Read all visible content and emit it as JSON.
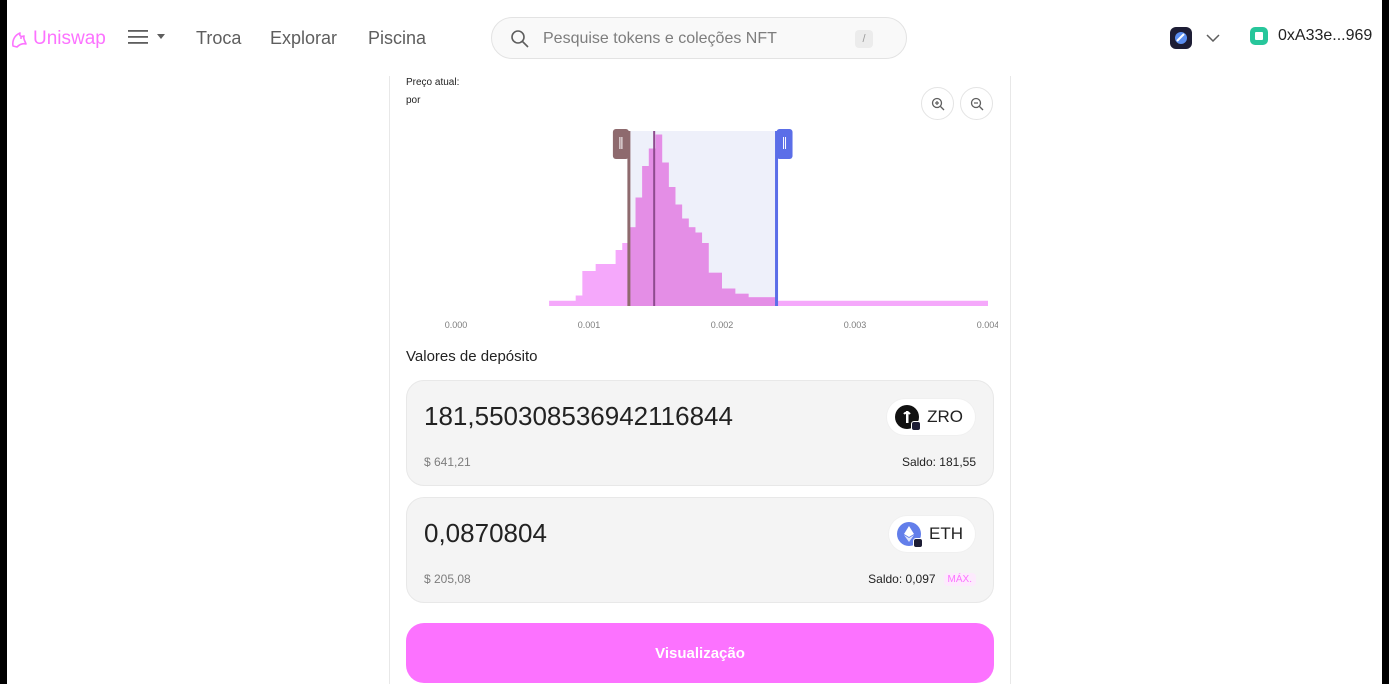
{
  "header": {
    "brand": "Uniswap",
    "nav": [
      "Troca",
      "Explorar",
      "Piscina"
    ],
    "search": {
      "placeholder": "Pesquise tokens e coleções NFT",
      "shortcut": "/"
    },
    "wallet_address": "0xA33e...969"
  },
  "range": {
    "price_label": "Preço atual:",
    "price_sub": "por"
  },
  "chart_data": {
    "type": "area",
    "x_ticks": [
      "0.000",
      "0.001",
      "0.002",
      "0.003",
      "0.004"
    ],
    "xlim": [
      0,
      0.004
    ],
    "current_price": 0.00149,
    "range_min": 0.0013,
    "range_max": 0.00241,
    "liquidity": [
      [
        0.0,
        0.0
      ],
      [
        0.0005,
        0.0
      ],
      [
        0.0007,
        0.03
      ],
      [
        0.0009,
        0.06
      ],
      [
        0.00095,
        0.2
      ],
      [
        0.00105,
        0.24
      ],
      [
        0.0012,
        0.32
      ],
      [
        0.00125,
        0.36
      ],
      [
        0.0013,
        0.45
      ],
      [
        0.00135,
        0.62
      ],
      [
        0.0014,
        0.8
      ],
      [
        0.00145,
        0.9
      ],
      [
        0.0015,
        0.98
      ],
      [
        0.00155,
        0.82
      ],
      [
        0.0016,
        0.68
      ],
      [
        0.00165,
        0.58
      ],
      [
        0.0017,
        0.5
      ],
      [
        0.00175,
        0.45
      ],
      [
        0.0018,
        0.42
      ],
      [
        0.00185,
        0.36
      ],
      [
        0.0019,
        0.19
      ],
      [
        0.002,
        0.1
      ],
      [
        0.0021,
        0.07
      ],
      [
        0.0022,
        0.05
      ],
      [
        0.0024,
        0.03
      ],
      [
        0.003,
        0.03
      ],
      [
        0.004,
        0.03
      ]
    ],
    "colors": {
      "area": "#f5a8fb",
      "area_in_range": "#e48ee6",
      "min_handle": "#8e6a6e",
      "max_handle": "#5b6ee8",
      "current": "#8e4b8e"
    }
  },
  "deposit": {
    "title": "Valores de depósito",
    "token0": {
      "amount": "181,550308536942116844",
      "usd": "$ 641,21",
      "symbol": "ZRO",
      "balance": "Saldo: 181,55"
    },
    "token1": {
      "amount": "0,0870804",
      "usd": "$ 205,08",
      "symbol": "ETH",
      "balance": "Saldo: 0,097",
      "max": "MÁX."
    }
  },
  "action": {
    "preview_label": "Visualização"
  },
  "colors": {
    "accent": "#fc72ff",
    "eth": "#627eea",
    "zro": "#111111"
  }
}
